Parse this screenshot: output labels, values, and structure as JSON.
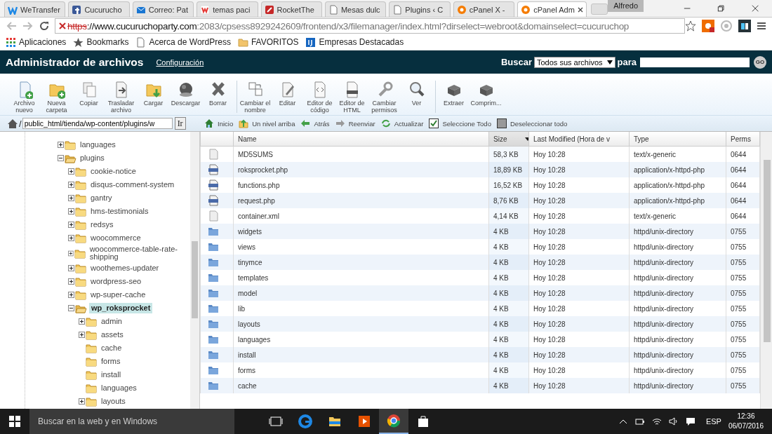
{
  "browser": {
    "tabs": [
      {
        "title": "WeTransfer",
        "selected": false
      },
      {
        "title": "Cucurucho",
        "selected": false
      },
      {
        "title": "Correo: Pat",
        "selected": false
      },
      {
        "title": "temas paci",
        "selected": false
      },
      {
        "title": "RocketThe",
        "selected": false
      },
      {
        "title": "Mesas dulc",
        "selected": false
      },
      {
        "title": "Plugins ‹ C",
        "selected": false
      },
      {
        "title": "cPanel X -",
        "selected": false
      },
      {
        "title": "cPanel Adm",
        "selected": true
      }
    ],
    "profile": "Alfredo",
    "url_parts": [
      {
        "text": "https",
        "kind": "insecure"
      },
      {
        "text": "://www.cucuruchoparty.com",
        "kind": "host"
      },
      {
        "text": ":2083/cpsess8929242609/frontend/x3/filemanager/index.html?dirselect=webroot&domainselect=cucuruchop",
        "kind": "path"
      }
    ],
    "bookmarks": [
      "Aplicaciones",
      "Bookmarks",
      "Acerca de WordPress",
      "FAVORITOS",
      "Empresas Destacadas"
    ]
  },
  "header": {
    "title": "Administrador de archivos",
    "settings_link": "Configuración",
    "search_label": "Buscar",
    "scope": "Todos sus archivos",
    "for_label": "para",
    "go": "GO"
  },
  "toolbar": [
    [
      {
        "label": "Archivo nuevo"
      },
      {
        "label": "Nueva carpeta"
      },
      {
        "label": "Copiar"
      },
      {
        "label": "Trasladar archivo"
      },
      {
        "label": "Cargar"
      },
      {
        "label": "Descargar"
      },
      {
        "label": "Borrar"
      }
    ],
    [
      {
        "label": "Cambiar el nombre"
      },
      {
        "label": "Editar"
      },
      {
        "label": "Editor de código"
      },
      {
        "label": "Editor de HTML"
      },
      {
        "label": "Cambiar permisos"
      },
      {
        "label": "Ver"
      }
    ],
    [
      {
        "label": "Extraer"
      },
      {
        "label": "Comprim..."
      }
    ]
  ],
  "path": {
    "root": "/",
    "value": "public_html/tienda/wp-content/plugins/w",
    "go": "Ir"
  },
  "actions": [
    {
      "label": "Inicio"
    },
    {
      "label": "Un nivel arriba"
    },
    {
      "label": "Atrás"
    },
    {
      "label": "Reenviar"
    },
    {
      "label": "Actualizar"
    },
    {
      "label": "Seleccione Todo"
    },
    {
      "label": "Deseleccionar todo"
    }
  ],
  "tree": [
    {
      "name": "languages",
      "expandable": true,
      "expanded": false,
      "selected": false
    },
    {
      "name": "plugins",
      "expandable": true,
      "expanded": true,
      "selected": false,
      "children": [
        {
          "name": "cookie-notice",
          "expandable": true,
          "expanded": false,
          "selected": false
        },
        {
          "name": "disqus-comment-system",
          "expandable": true,
          "expanded": false,
          "selected": false
        },
        {
          "name": "gantry",
          "expandable": true,
          "expanded": false,
          "selected": false
        },
        {
          "name": "hms-testimonials",
          "expandable": true,
          "expanded": false,
          "selected": false
        },
        {
          "name": "redsys",
          "expandable": true,
          "expanded": false,
          "selected": false
        },
        {
          "name": "woocommerce",
          "expandable": true,
          "expanded": false,
          "selected": false
        },
        {
          "name": "woocommerce-table-rate-shipping",
          "expandable": true,
          "expanded": false,
          "selected": false
        },
        {
          "name": "woothemes-updater",
          "expandable": true,
          "expanded": false,
          "selected": false
        },
        {
          "name": "wordpress-seo",
          "expandable": true,
          "expanded": false,
          "selected": false
        },
        {
          "name": "wp-super-cache",
          "expandable": true,
          "expanded": false,
          "selected": false
        },
        {
          "name": "wp_roksprocket",
          "expandable": true,
          "expanded": true,
          "selected": true,
          "children": [
            {
              "name": "admin",
              "expandable": true,
              "expanded": false,
              "selected": false
            },
            {
              "name": "assets",
              "expandable": true,
              "expanded": false,
              "selected": false
            },
            {
              "name": "cache",
              "expandable": false,
              "expanded": false,
              "selected": false
            },
            {
              "name": "forms",
              "expandable": false,
              "expanded": false,
              "selected": false
            },
            {
              "name": "install",
              "expandable": false,
              "expanded": false,
              "selected": false
            },
            {
              "name": "languages",
              "expandable": false,
              "expanded": false,
              "selected": false
            },
            {
              "name": "layouts",
              "expandable": true,
              "expanded": false,
              "selected": false
            }
          ]
        }
      ]
    }
  ],
  "table": {
    "columns": [
      {
        "label": "Name",
        "sorted": false
      },
      {
        "label": "Size",
        "sorted": true
      },
      {
        "label": "Last Modified (Hora de v",
        "sorted": false
      },
      {
        "label": "Type",
        "sorted": false
      },
      {
        "label": "Perms",
        "sorted": false
      }
    ],
    "rows": [
      {
        "kind": "file",
        "name": "MD5SUMS",
        "size": "58,3 KB",
        "modified": "Hoy 10:28",
        "type": "text/x-generic",
        "perms": "0644"
      },
      {
        "kind": "php",
        "name": "roksprocket.php",
        "size": "18,89 KB",
        "modified": "Hoy 10:28",
        "type": "application/x-httpd-php",
        "perms": "0644"
      },
      {
        "kind": "php",
        "name": "functions.php",
        "size": "16,52 KB",
        "modified": "Hoy 10:28",
        "type": "application/x-httpd-php",
        "perms": "0644"
      },
      {
        "kind": "php",
        "name": "request.php",
        "size": "8,76 KB",
        "modified": "Hoy 10:28",
        "type": "application/x-httpd-php",
        "perms": "0644"
      },
      {
        "kind": "file",
        "name": "container.xml",
        "size": "4,14 KB",
        "modified": "Hoy 10:28",
        "type": "text/x-generic",
        "perms": "0644"
      },
      {
        "kind": "folder",
        "name": "widgets",
        "size": "4 KB",
        "modified": "Hoy 10:28",
        "type": "httpd/unix-directory",
        "perms": "0755"
      },
      {
        "kind": "folder",
        "name": "views",
        "size": "4 KB",
        "modified": "Hoy 10:28",
        "type": "httpd/unix-directory",
        "perms": "0755"
      },
      {
        "kind": "folder",
        "name": "tinymce",
        "size": "4 KB",
        "modified": "Hoy 10:28",
        "type": "httpd/unix-directory",
        "perms": "0755"
      },
      {
        "kind": "folder",
        "name": "templates",
        "size": "4 KB",
        "modified": "Hoy 10:28",
        "type": "httpd/unix-directory",
        "perms": "0755"
      },
      {
        "kind": "folder",
        "name": "model",
        "size": "4 KB",
        "modified": "Hoy 10:28",
        "type": "httpd/unix-directory",
        "perms": "0755"
      },
      {
        "kind": "folder",
        "name": "lib",
        "size": "4 KB",
        "modified": "Hoy 10:28",
        "type": "httpd/unix-directory",
        "perms": "0755"
      },
      {
        "kind": "folder",
        "name": "layouts",
        "size": "4 KB",
        "modified": "Hoy 10:28",
        "type": "httpd/unix-directory",
        "perms": "0755"
      },
      {
        "kind": "folder",
        "name": "languages",
        "size": "4 KB",
        "modified": "Hoy 10:28",
        "type": "httpd/unix-directory",
        "perms": "0755"
      },
      {
        "kind": "folder",
        "name": "install",
        "size": "4 KB",
        "modified": "Hoy 10:28",
        "type": "httpd/unix-directory",
        "perms": "0755"
      },
      {
        "kind": "folder",
        "name": "forms",
        "size": "4 KB",
        "modified": "Hoy 10:28",
        "type": "httpd/unix-directory",
        "perms": "0755"
      },
      {
        "kind": "folder",
        "name": "cache",
        "size": "4 KB",
        "modified": "Hoy 10:28",
        "type": "httpd/unix-directory",
        "perms": "0755"
      }
    ]
  },
  "taskbar": {
    "search_placeholder": "Buscar en la web y en Windows",
    "language": "ESP",
    "time": "12:36",
    "date": "06/07/2016",
    "apps": [
      {
        "selected": false
      },
      {
        "selected": false
      },
      {
        "selected": false
      },
      {
        "selected": false
      },
      {
        "selected": true
      },
      {
        "selected": false
      }
    ]
  }
}
